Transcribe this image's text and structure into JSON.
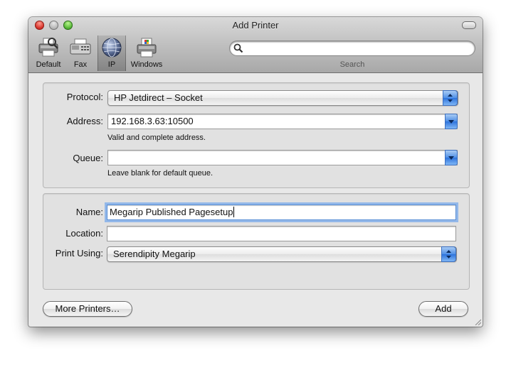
{
  "window": {
    "title": "Add Printer"
  },
  "toolbar": {
    "items": [
      {
        "label": "Default",
        "icon": "default-printer-icon"
      },
      {
        "label": "Fax",
        "icon": "fax-icon"
      },
      {
        "label": "IP",
        "icon": "globe-icon",
        "selected": true
      },
      {
        "label": "Windows",
        "icon": "windows-printer-icon"
      }
    ],
    "search": {
      "label": "Search",
      "value": "",
      "placeholder": ""
    }
  },
  "connection": {
    "protocol_label": "Protocol:",
    "protocol_value": "HP Jetdirect – Socket",
    "address_label": "Address:",
    "address_value": "192.168.3.63:10500",
    "address_hint": "Valid and complete address.",
    "queue_label": "Queue:",
    "queue_value": "",
    "queue_hint": "Leave blank for default queue."
  },
  "details": {
    "name_label": "Name:",
    "name_value": "Megarip Published Pagesetup",
    "location_label": "Location:",
    "location_value": "",
    "print_using_label": "Print Using:",
    "print_using_value": "Serendipity Megarip"
  },
  "buttons": {
    "more_printers": "More Printers…",
    "add": "Add"
  },
  "colors": {
    "accent": "#4f8fe6",
    "focus_ring": "#78aaeb"
  }
}
